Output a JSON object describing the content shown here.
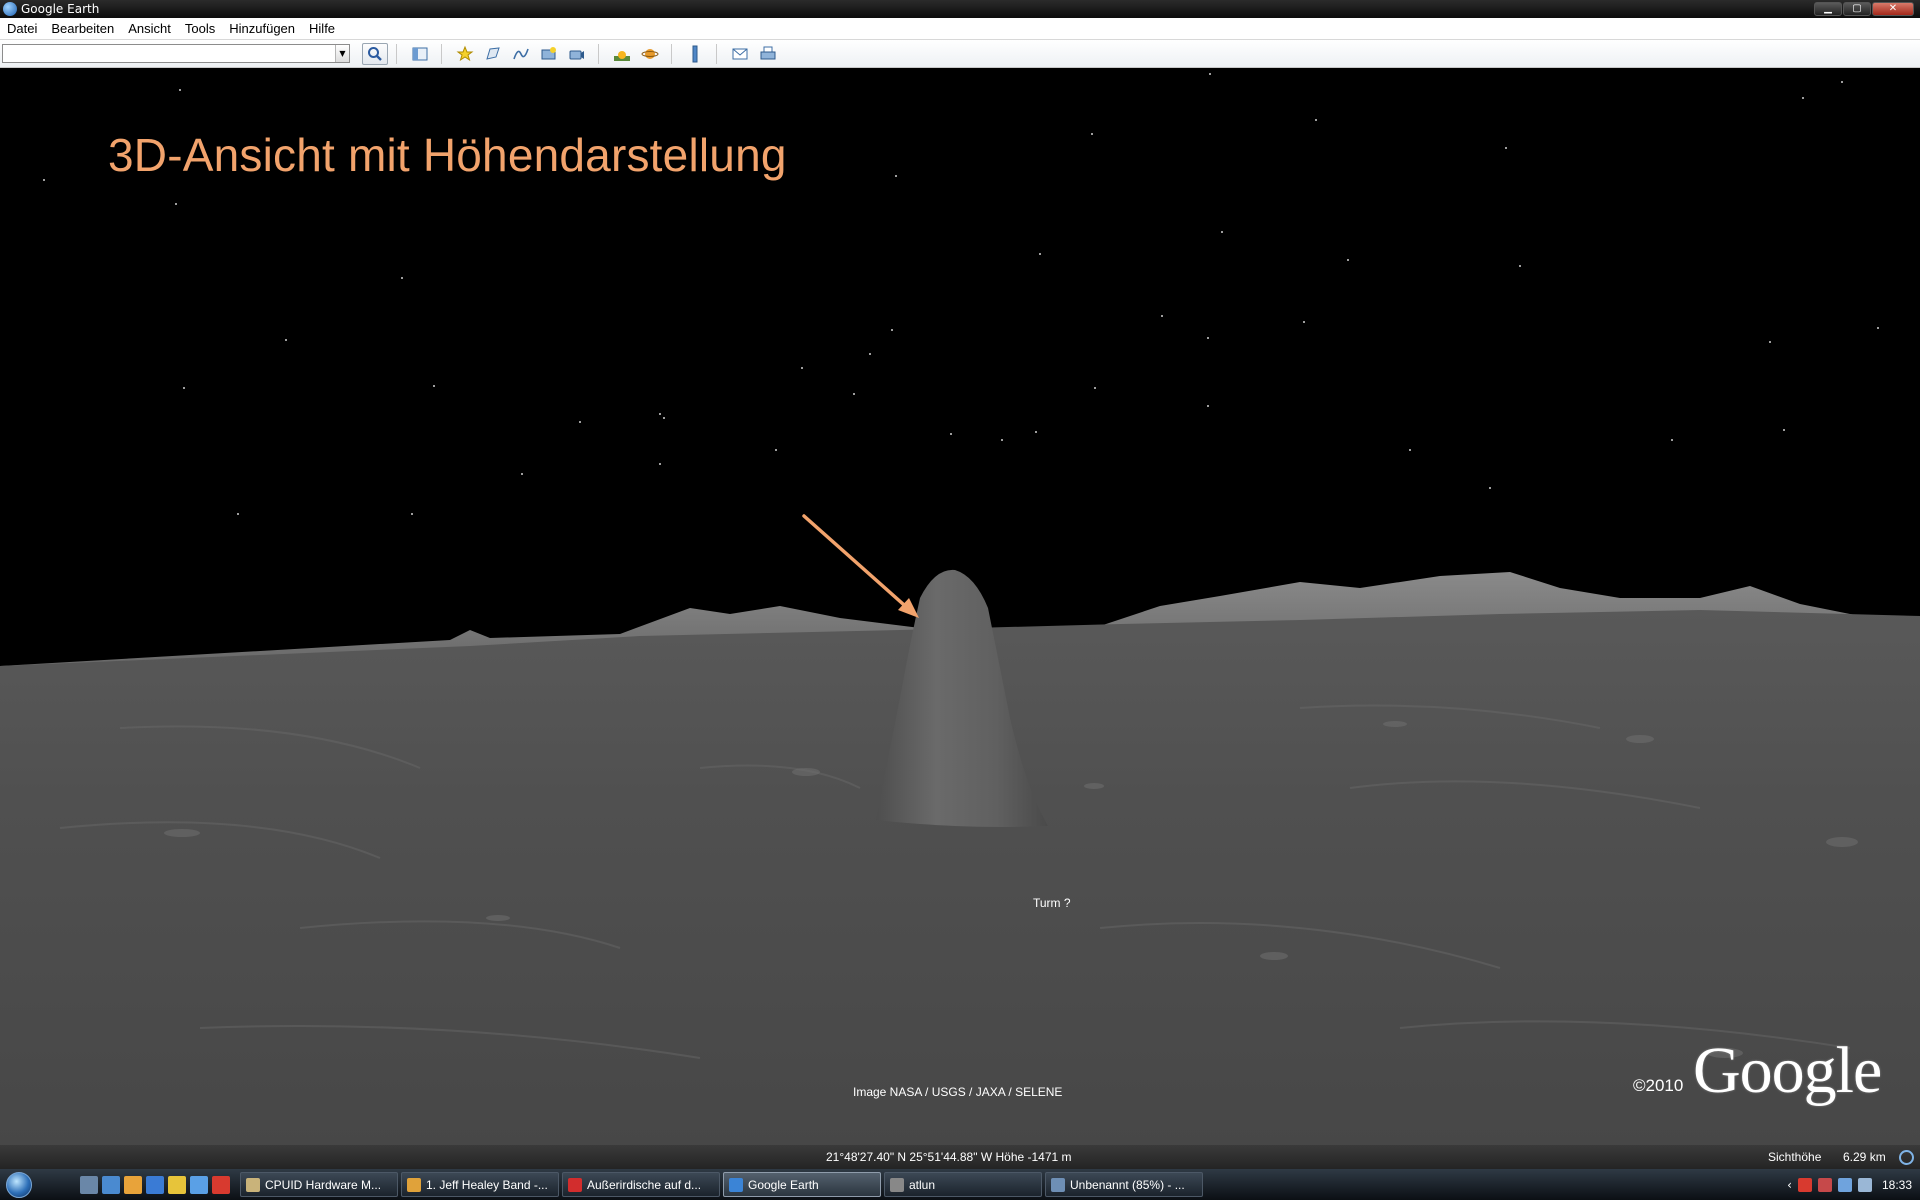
{
  "window": {
    "title": "Google Earth",
    "controls": {
      "minimize": "▁",
      "maximize": "▢",
      "close": "✕"
    }
  },
  "menu": {
    "items": [
      "Datei",
      "Bearbeiten",
      "Ansicht",
      "Tools",
      "Hinzufügen",
      "Hilfe"
    ]
  },
  "toolbar": {
    "search_value": "",
    "buttons": [
      "search-icon",
      "sidebar-toggle-icon",
      "placemark-icon",
      "polygon-icon",
      "path-icon",
      "image-overlay-icon",
      "record-tour-icon",
      "sunlight-icon",
      "planet-switch-icon",
      "ruler-icon",
      "email-icon",
      "print-icon"
    ]
  },
  "view": {
    "heading": "3D-Ansicht mit Höhendarstellung",
    "placemark_label": "Turm ?",
    "imagery_credit": "Image NASA / USGS / JAXA / SELENE",
    "copyright": "©2010",
    "logo": "Google",
    "arrow_color": "#f2a36c"
  },
  "status": {
    "coords": "21°48'27.40\" N  25°51'44.88\" W  Höhe -1471 m",
    "eye_alt_label": "Sichthöhe",
    "eye_alt_value": "6.29 km"
  },
  "taskbar": {
    "tasks": [
      {
        "label": "CPUID Hardware M...",
        "icon_color": "#c9b37a",
        "active": false
      },
      {
        "label": "1. Jeff Healey Band -...",
        "icon_color": "#e0a23a",
        "active": false
      },
      {
        "label": "Außerirdische auf d...",
        "icon_color": "#d22d2d",
        "active": false
      },
      {
        "label": "Google Earth",
        "icon_color": "#3b84d6",
        "active": true
      },
      {
        "label": "atlun",
        "icon_color": "#888888",
        "active": false
      },
      {
        "label": "Unbenannt (85%) - ...",
        "icon_color": "#6e8fb5",
        "active": false
      }
    ],
    "clock": "18:33"
  }
}
